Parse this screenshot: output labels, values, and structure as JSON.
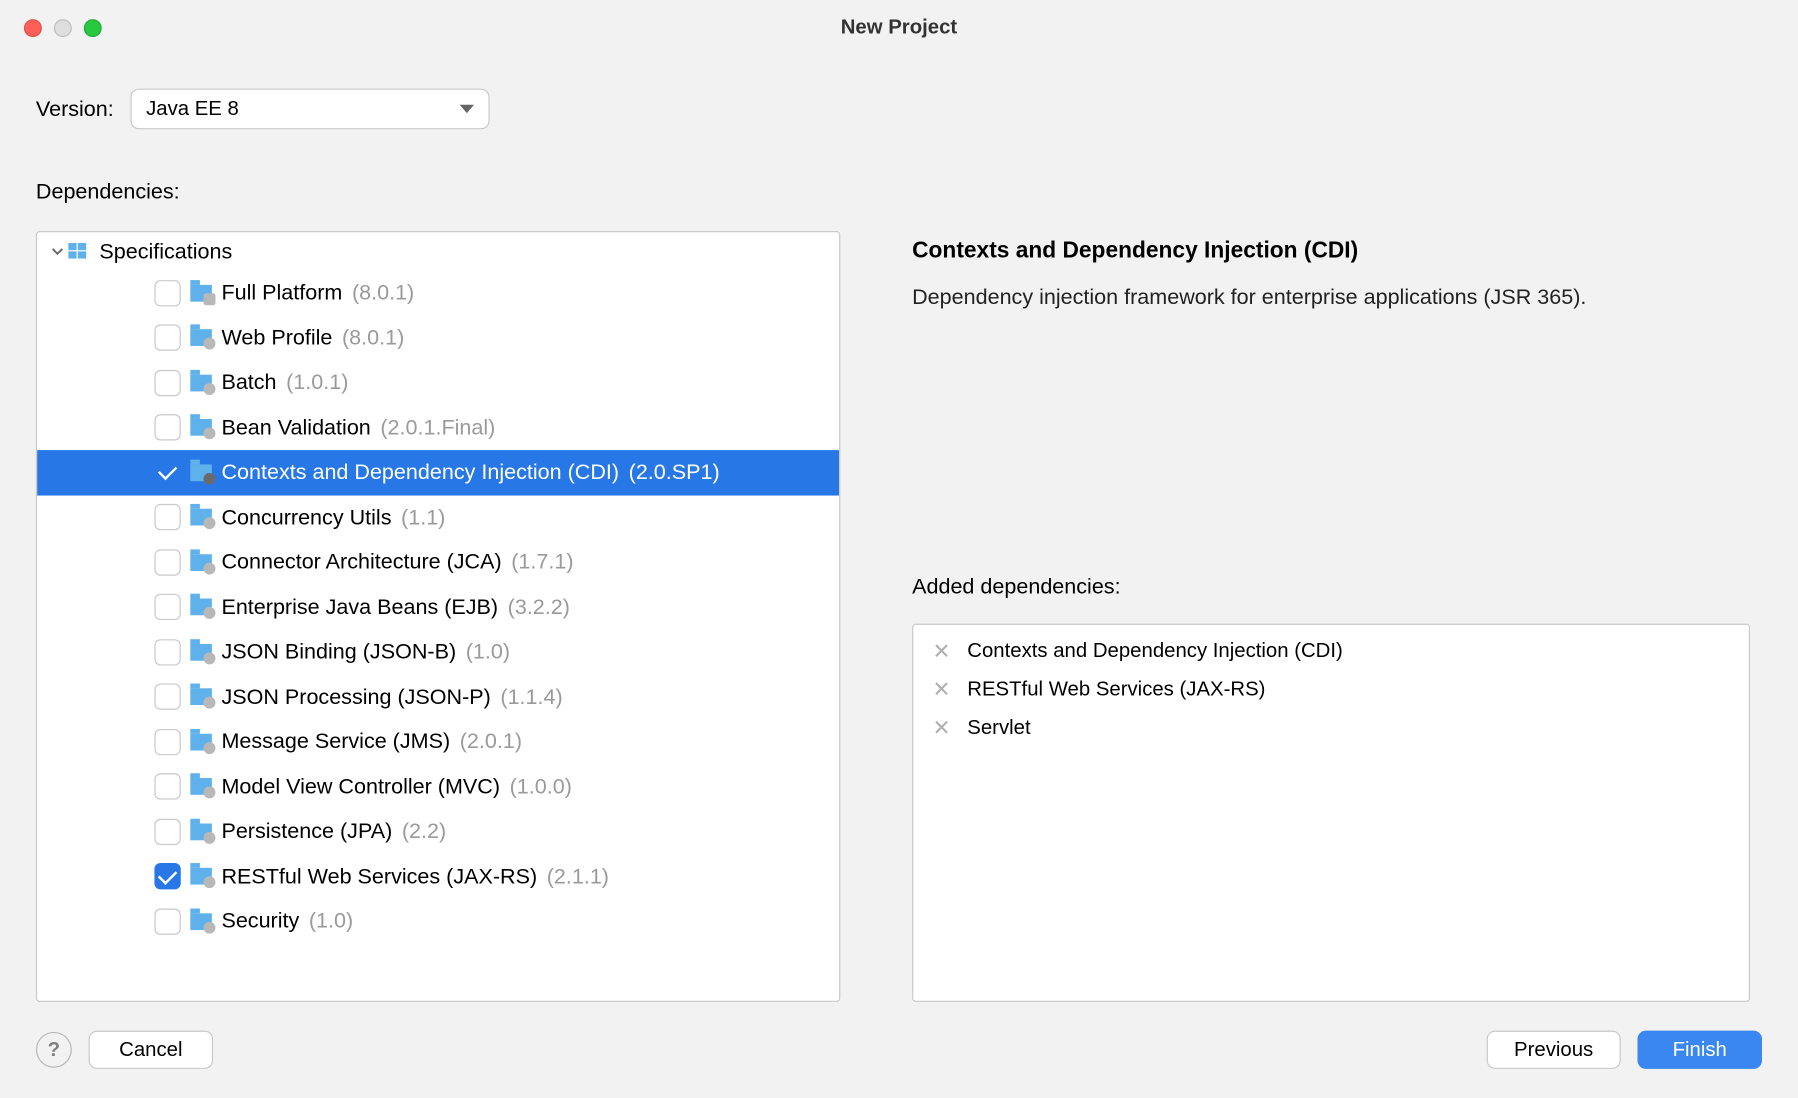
{
  "window": {
    "title": "New Project"
  },
  "version": {
    "label": "Version:",
    "value": "Java EE 8"
  },
  "dependencies": {
    "label": "Dependencies:",
    "tree_header": "Specifications",
    "items": [
      {
        "name": "Full Platform",
        "version": "(8.0.1)",
        "checked": false,
        "selected": false,
        "icon_variant": "sq"
      },
      {
        "name": "Web Profile",
        "version": "(8.0.1)",
        "checked": false,
        "selected": false,
        "icon_variant": "plain"
      },
      {
        "name": "Batch",
        "version": "(1.0.1)",
        "checked": false,
        "selected": false,
        "icon_variant": "plain"
      },
      {
        "name": "Bean Validation",
        "version": "(2.0.1.Final)",
        "checked": false,
        "selected": false,
        "icon_variant": "plain"
      },
      {
        "name": "Contexts and Dependency Injection (CDI)",
        "version": "(2.0.SP1)",
        "checked": true,
        "selected": true,
        "icon_variant": "dk"
      },
      {
        "name": "Concurrency Utils",
        "version": "(1.1)",
        "checked": false,
        "selected": false,
        "icon_variant": "plain"
      },
      {
        "name": "Connector Architecture (JCA)",
        "version": "(1.7.1)",
        "checked": false,
        "selected": false,
        "icon_variant": "plain"
      },
      {
        "name": "Enterprise Java Beans (EJB)",
        "version": "(3.2.2)",
        "checked": false,
        "selected": false,
        "icon_variant": "plain"
      },
      {
        "name": "JSON Binding (JSON-B)",
        "version": "(1.0)",
        "checked": false,
        "selected": false,
        "icon_variant": "plain"
      },
      {
        "name": "JSON Processing (JSON-P)",
        "version": "(1.1.4)",
        "checked": false,
        "selected": false,
        "icon_variant": "plain"
      },
      {
        "name": "Message Service (JMS)",
        "version": "(2.0.1)",
        "checked": false,
        "selected": false,
        "icon_variant": "plain"
      },
      {
        "name": "Model View Controller (MVC)",
        "version": "(1.0.0)",
        "checked": false,
        "selected": false,
        "icon_variant": "plain"
      },
      {
        "name": "Persistence (JPA)",
        "version": "(2.2)",
        "checked": false,
        "selected": false,
        "icon_variant": "plain"
      },
      {
        "name": "RESTful Web Services (JAX-RS)",
        "version": "(2.1.1)",
        "checked": true,
        "selected": false,
        "icon_variant": "plain"
      },
      {
        "name": "Security",
        "version": "(1.0)",
        "checked": false,
        "selected": false,
        "icon_variant": "plain"
      }
    ]
  },
  "detail": {
    "title": "Contexts and Dependency Injection (CDI)",
    "description": "Dependency injection framework for enterprise applications (JSR 365)."
  },
  "added": {
    "label": "Added dependencies:",
    "items": [
      "Contexts and Dependency Injection (CDI)",
      "RESTful Web Services (JAX-RS)",
      "Servlet"
    ]
  },
  "footer": {
    "help": "?",
    "cancel": "Cancel",
    "previous": "Previous",
    "finish": "Finish"
  }
}
